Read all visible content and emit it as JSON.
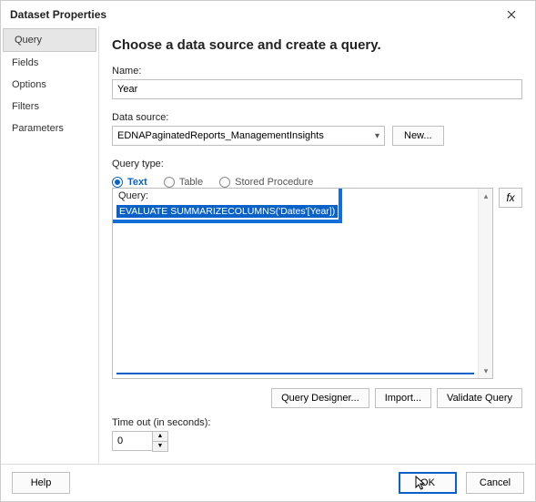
{
  "title": "Dataset Properties",
  "sidebar": {
    "items": [
      {
        "label": "Query",
        "selected": true
      },
      {
        "label": "Fields"
      },
      {
        "label": "Options"
      },
      {
        "label": "Filters"
      },
      {
        "label": "Parameters"
      }
    ]
  },
  "main": {
    "heading": "Choose a data source and create a query.",
    "name_label": "Name:",
    "name_value": "Year",
    "datasource_label": "Data source:",
    "datasource_value": "EDNAPaginatedReports_ManagementInsights",
    "new_button": "New...",
    "querytype_label": "Query type:",
    "querytype_options": [
      {
        "label": "Text",
        "selected": true
      },
      {
        "label": "Table"
      },
      {
        "label": "Stored Procedure"
      }
    ],
    "query_label": "Query:",
    "query_text": "EVALUATE SUMMARIZECOLUMNS('Dates'[Year])",
    "fx_label": "fx",
    "query_designer": "Query Designer...",
    "import": "Import...",
    "validate": "Validate Query",
    "timeout_label": "Time out (in seconds):",
    "timeout_value": "0"
  },
  "footer": {
    "help": "Help",
    "ok": "OK",
    "cancel": "Cancel"
  }
}
